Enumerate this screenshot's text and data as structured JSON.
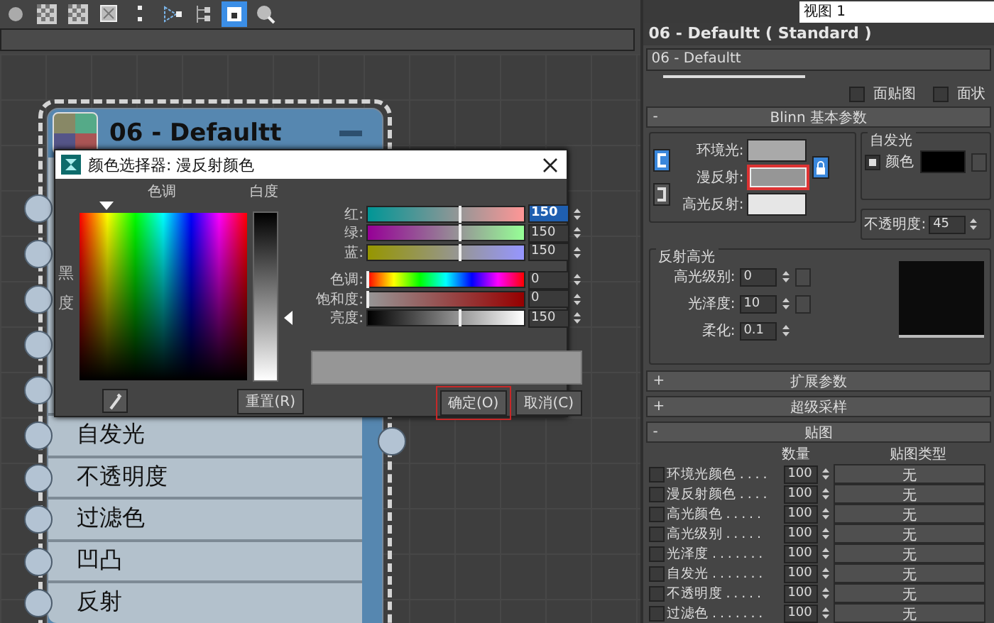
{
  "toolbar": [
    {
      "kind": "material",
      "selected": false
    },
    {
      "kind": "checker",
      "selected": false
    },
    {
      "kind": "checker",
      "selected": false
    },
    {
      "kind": "box",
      "selected": false
    },
    {
      "kind": "dots",
      "selected": false
    },
    {
      "kind": "arrange",
      "selected": false
    },
    {
      "kind": "tree",
      "selected": false
    },
    {
      "kind": "layout",
      "selected": true
    },
    {
      "kind": "zoom",
      "selected": false
    }
  ],
  "view_field": {
    "value": "视图 1"
  },
  "node": {
    "title": "06 - Defaultt",
    "slots": [
      "自发光",
      "不透明度",
      "过滤色",
      "凹凸",
      "反射"
    ]
  },
  "color_dialog": {
    "title": "颜色选择器: 漫反射颜色",
    "hue_label": "色调",
    "whiteness_label": "白度",
    "blackness_label": "黑度",
    "rgb_channels": [
      {
        "kind": "red",
        "label": "红:",
        "value": "150",
        "level": 0.588,
        "selected": true
      },
      {
        "kind": "green",
        "label": "绿:",
        "value": "150",
        "level": 0.588,
        "selected": false
      },
      {
        "kind": "blue",
        "label": "蓝:",
        "value": "150",
        "level": 0.588,
        "selected": false
      }
    ],
    "hsv_channels": [
      {
        "kind": "hue",
        "label": "色调:",
        "value": "0",
        "level": 0,
        "selected": false
      },
      {
        "kind": "saturation",
        "label": "饱和度:",
        "value": "0",
        "level": 0,
        "selected": false
      },
      {
        "kind": "value",
        "label": "亮度:",
        "value": "150",
        "level": 0.588,
        "selected": false
      }
    ],
    "reset_button": "重置(R)",
    "ok_button": "确定(O)",
    "cancel_button": "取消(C)"
  },
  "material": {
    "title": "06 - Defaultt  ( Standard )",
    "name": "06 - Defaultt",
    "options": [
      {
        "label": "面贴图",
        "checked": false
      },
      {
        "label": "面状",
        "checked": false
      }
    ],
    "blinn": {
      "sign": "-",
      "title": "Blinn 基本参数",
      "colors": [
        {
          "label": "环境光:",
          "color": "#a9a9a9",
          "selected": false
        },
        {
          "label": "漫反射:",
          "color": "#969696",
          "selected": true
        },
        {
          "label": "高光反射:",
          "color": "#e6e6e6",
          "selected": false
        }
      ],
      "self_illum": {
        "title": "自发光",
        "label": "颜色",
        "checked": true,
        "color": "#000000"
      },
      "opacity": {
        "label": "不透明度:",
        "value": "45"
      },
      "highlights": {
        "title": "反射高光",
        "fields": [
          {
            "label": "高光级别:",
            "value": "0"
          },
          {
            "label": "光泽度:",
            "value": "10"
          },
          {
            "label": "柔化:",
            "value": "0.1"
          }
        ]
      }
    },
    "collapsed_rollouts": [
      {
        "sign": "+",
        "title": "扩展参数"
      },
      {
        "sign": "+",
        "title": "超级采样"
      }
    ],
    "maps": {
      "sign": "-",
      "title": "贴图",
      "columns": [
        "数量",
        "贴图类型"
      ],
      "rows": [
        {
          "label": "环境光颜色 . . . .",
          "checked": false,
          "amount": "100",
          "map": "无"
        },
        {
          "label": "漫反射颜色 . . . .",
          "checked": false,
          "amount": "100",
          "map": "无"
        },
        {
          "label": "高光颜色 . . . . .",
          "checked": false,
          "amount": "100",
          "map": "无"
        },
        {
          "label": "高光级别 . . . . .",
          "checked": false,
          "amount": "100",
          "map": "无"
        },
        {
          "label": "光泽度 . . . . . . .",
          "checked": false,
          "amount": "100",
          "map": "无"
        },
        {
          "label": "自发光 . . . . . . .",
          "checked": false,
          "amount": "100",
          "map": "无"
        },
        {
          "label": "不透明度 . . . . .",
          "checked": false,
          "amount": "100",
          "map": "无"
        },
        {
          "label": "过滤色 . . . . . . .",
          "checked": false,
          "amount": "100",
          "map": "无"
        }
      ]
    }
  }
}
